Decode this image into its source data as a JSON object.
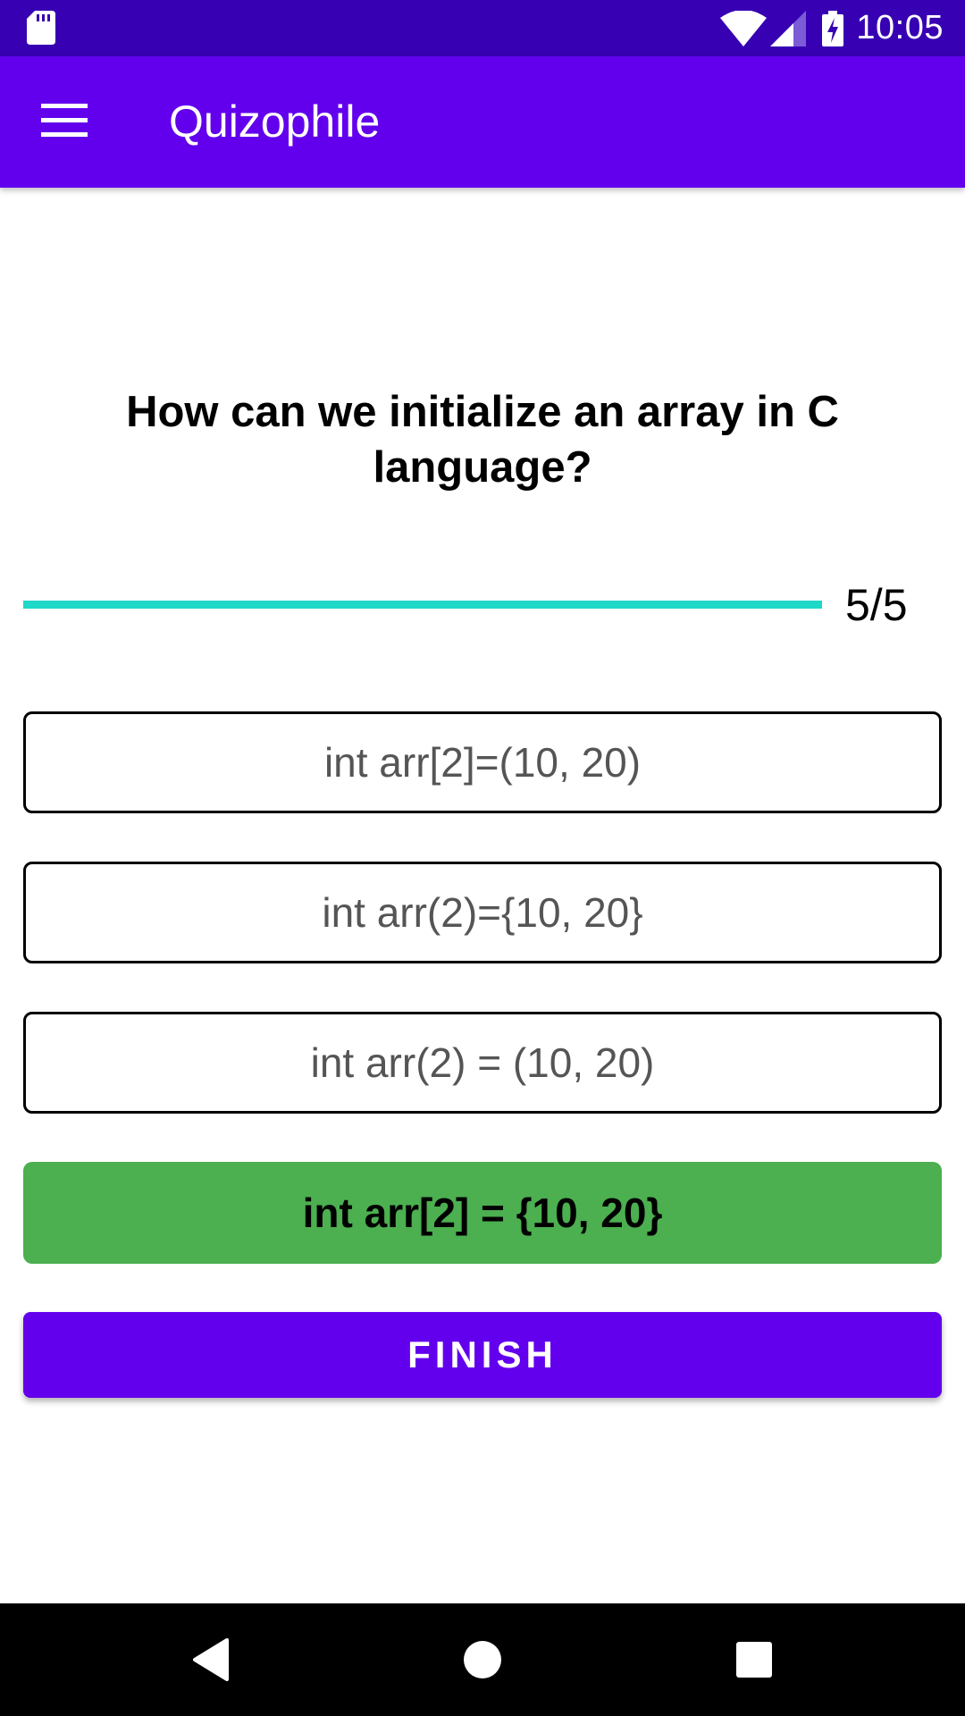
{
  "status_bar": {
    "time": "10:05",
    "icons": [
      "sd-card-icon",
      "wifi-icon",
      "cell-signal-icon",
      "battery-charging-icon"
    ]
  },
  "app_bar": {
    "title": "Quizophile",
    "menu_icon": "menu-icon"
  },
  "quiz": {
    "question": "How can we initialize an array in C language?",
    "progress": {
      "current": 5,
      "total": 5,
      "label": "5/5",
      "fraction": 1.0
    },
    "options": [
      {
        "text": "int arr[2]=(10, 20)",
        "state": "default"
      },
      {
        "text": "int arr(2)={10, 20}",
        "state": "default"
      },
      {
        "text": "int arr(2) = (10, 20)",
        "state": "default"
      },
      {
        "text": "int arr[2] = {10, 20}",
        "state": "correct"
      }
    ],
    "finish_label": "FINISH"
  },
  "nav_bar": {
    "icons": [
      "back-icon",
      "home-icon",
      "recents-icon"
    ]
  },
  "colors": {
    "status_bar": "#3700b3",
    "primary": "#6200ee",
    "progress": "#1ed8c8",
    "correct": "#4caf50"
  }
}
